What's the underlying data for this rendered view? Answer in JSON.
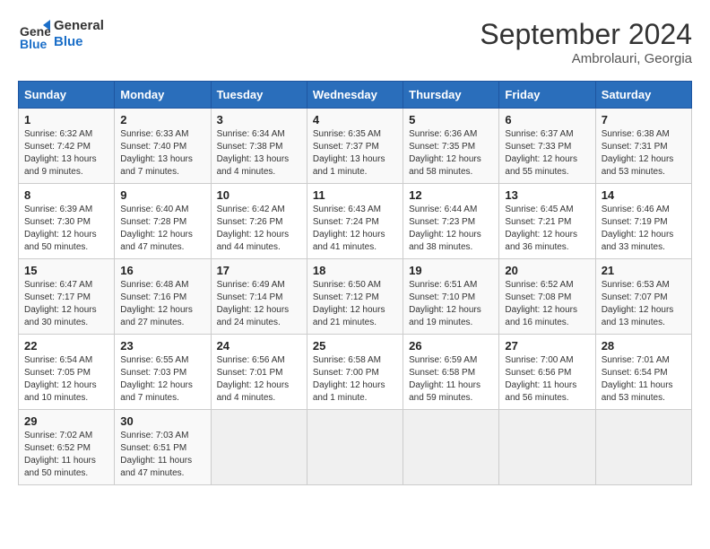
{
  "logo": {
    "line1": "General",
    "line2": "Blue"
  },
  "title": "September 2024",
  "subtitle": "Ambrolauri, Georgia",
  "days_of_week": [
    "Sunday",
    "Monday",
    "Tuesday",
    "Wednesday",
    "Thursday",
    "Friday",
    "Saturday"
  ],
  "weeks": [
    [
      {
        "day": "1",
        "info": "Sunrise: 6:32 AM\nSunset: 7:42 PM\nDaylight: 13 hours\nand 9 minutes."
      },
      {
        "day": "2",
        "info": "Sunrise: 6:33 AM\nSunset: 7:40 PM\nDaylight: 13 hours\nand 7 minutes."
      },
      {
        "day": "3",
        "info": "Sunrise: 6:34 AM\nSunset: 7:38 PM\nDaylight: 13 hours\nand 4 minutes."
      },
      {
        "day": "4",
        "info": "Sunrise: 6:35 AM\nSunset: 7:37 PM\nDaylight: 13 hours\nand 1 minute."
      },
      {
        "day": "5",
        "info": "Sunrise: 6:36 AM\nSunset: 7:35 PM\nDaylight: 12 hours\nand 58 minutes."
      },
      {
        "day": "6",
        "info": "Sunrise: 6:37 AM\nSunset: 7:33 PM\nDaylight: 12 hours\nand 55 minutes."
      },
      {
        "day": "7",
        "info": "Sunrise: 6:38 AM\nSunset: 7:31 PM\nDaylight: 12 hours\nand 53 minutes."
      }
    ],
    [
      {
        "day": "8",
        "info": "Sunrise: 6:39 AM\nSunset: 7:30 PM\nDaylight: 12 hours\nand 50 minutes."
      },
      {
        "day": "9",
        "info": "Sunrise: 6:40 AM\nSunset: 7:28 PM\nDaylight: 12 hours\nand 47 minutes."
      },
      {
        "day": "10",
        "info": "Sunrise: 6:42 AM\nSunset: 7:26 PM\nDaylight: 12 hours\nand 44 minutes."
      },
      {
        "day": "11",
        "info": "Sunrise: 6:43 AM\nSunset: 7:24 PM\nDaylight: 12 hours\nand 41 minutes."
      },
      {
        "day": "12",
        "info": "Sunrise: 6:44 AM\nSunset: 7:23 PM\nDaylight: 12 hours\nand 38 minutes."
      },
      {
        "day": "13",
        "info": "Sunrise: 6:45 AM\nSunset: 7:21 PM\nDaylight: 12 hours\nand 36 minutes."
      },
      {
        "day": "14",
        "info": "Sunrise: 6:46 AM\nSunset: 7:19 PM\nDaylight: 12 hours\nand 33 minutes."
      }
    ],
    [
      {
        "day": "15",
        "info": "Sunrise: 6:47 AM\nSunset: 7:17 PM\nDaylight: 12 hours\nand 30 minutes."
      },
      {
        "day": "16",
        "info": "Sunrise: 6:48 AM\nSunset: 7:16 PM\nDaylight: 12 hours\nand 27 minutes."
      },
      {
        "day": "17",
        "info": "Sunrise: 6:49 AM\nSunset: 7:14 PM\nDaylight: 12 hours\nand 24 minutes."
      },
      {
        "day": "18",
        "info": "Sunrise: 6:50 AM\nSunset: 7:12 PM\nDaylight: 12 hours\nand 21 minutes."
      },
      {
        "day": "19",
        "info": "Sunrise: 6:51 AM\nSunset: 7:10 PM\nDaylight: 12 hours\nand 19 minutes."
      },
      {
        "day": "20",
        "info": "Sunrise: 6:52 AM\nSunset: 7:08 PM\nDaylight: 12 hours\nand 16 minutes."
      },
      {
        "day": "21",
        "info": "Sunrise: 6:53 AM\nSunset: 7:07 PM\nDaylight: 12 hours\nand 13 minutes."
      }
    ],
    [
      {
        "day": "22",
        "info": "Sunrise: 6:54 AM\nSunset: 7:05 PM\nDaylight: 12 hours\nand 10 minutes."
      },
      {
        "day": "23",
        "info": "Sunrise: 6:55 AM\nSunset: 7:03 PM\nDaylight: 12 hours\nand 7 minutes."
      },
      {
        "day": "24",
        "info": "Sunrise: 6:56 AM\nSunset: 7:01 PM\nDaylight: 12 hours\nand 4 minutes."
      },
      {
        "day": "25",
        "info": "Sunrise: 6:58 AM\nSunset: 7:00 PM\nDaylight: 12 hours\nand 1 minute."
      },
      {
        "day": "26",
        "info": "Sunrise: 6:59 AM\nSunset: 6:58 PM\nDaylight: 11 hours\nand 59 minutes."
      },
      {
        "day": "27",
        "info": "Sunrise: 7:00 AM\nSunset: 6:56 PM\nDaylight: 11 hours\nand 56 minutes."
      },
      {
        "day": "28",
        "info": "Sunrise: 7:01 AM\nSunset: 6:54 PM\nDaylight: 11 hours\nand 53 minutes."
      }
    ],
    [
      {
        "day": "29",
        "info": "Sunrise: 7:02 AM\nSunset: 6:52 PM\nDaylight: 11 hours\nand 50 minutes."
      },
      {
        "day": "30",
        "info": "Sunrise: 7:03 AM\nSunset: 6:51 PM\nDaylight: 11 hours\nand 47 minutes."
      },
      {
        "day": "",
        "info": ""
      },
      {
        "day": "",
        "info": ""
      },
      {
        "day": "",
        "info": ""
      },
      {
        "day": "",
        "info": ""
      },
      {
        "day": "",
        "info": ""
      }
    ]
  ]
}
